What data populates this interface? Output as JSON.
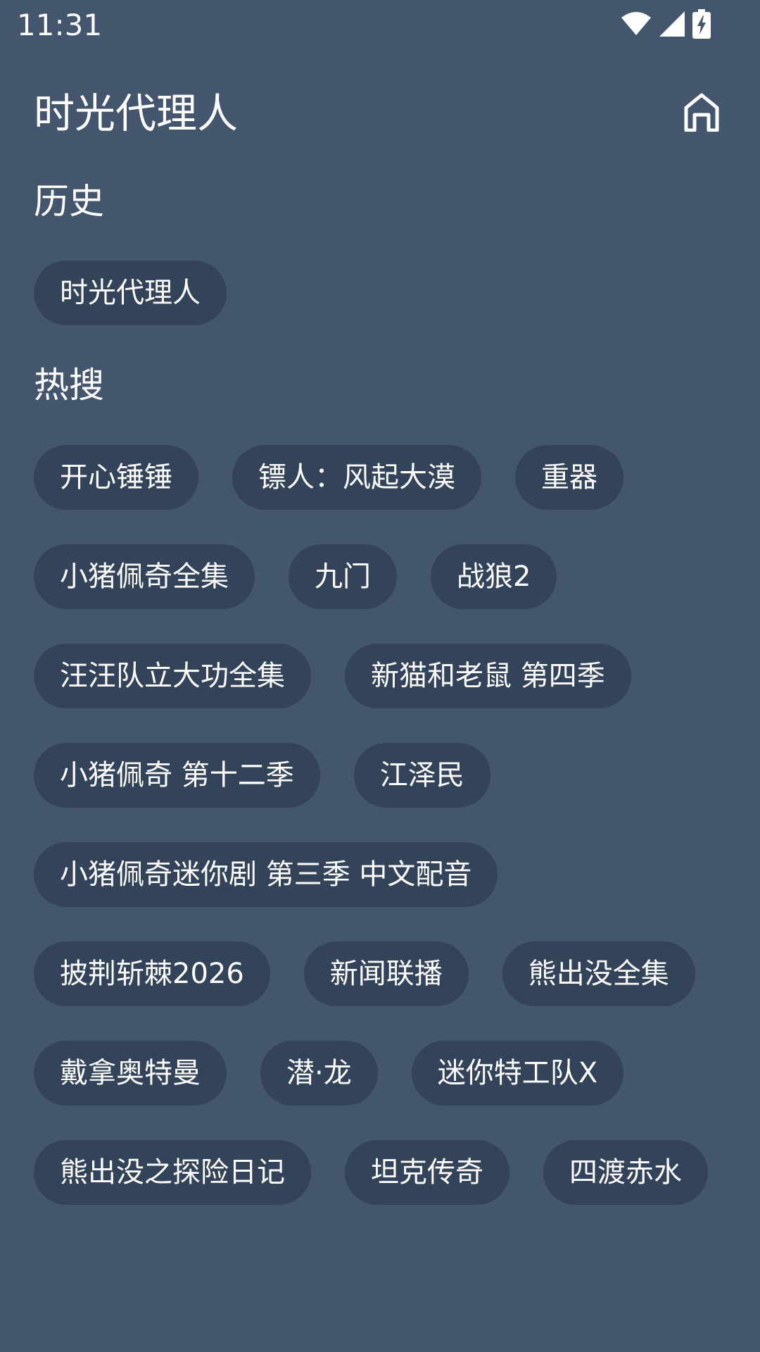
{
  "status_bar": {
    "time": "11:31",
    "icons": [
      "wifi-icon",
      "cellular-signal-icon",
      "battery-charging-icon"
    ]
  },
  "header": {
    "title": "时光代理人",
    "home_icon": "home-icon"
  },
  "history": {
    "heading": "历史",
    "items": [
      "时光代理人"
    ]
  },
  "hot_search": {
    "heading": "热搜",
    "items": [
      "开心锤锤",
      "镖人：风起大漠",
      "重器",
      "小猪佩奇全集",
      "九门",
      "战狼2",
      "汪汪队立大功全集",
      "新猫和老鼠 第四季",
      "小猪佩奇 第十二季",
      "江泽民",
      "小猪佩奇迷你剧 第三季 中文配音",
      "披荆斩棘2026",
      "新闻联播",
      "熊出没全集",
      "戴拿奥特曼",
      "潜·龙",
      "迷你特工队X",
      "熊出没之探险日记",
      "坦克传奇",
      "四渡赤水"
    ]
  },
  "colors": {
    "background": "#44556E",
    "chip_background": "#33435A",
    "text": "#FFFFFF"
  }
}
